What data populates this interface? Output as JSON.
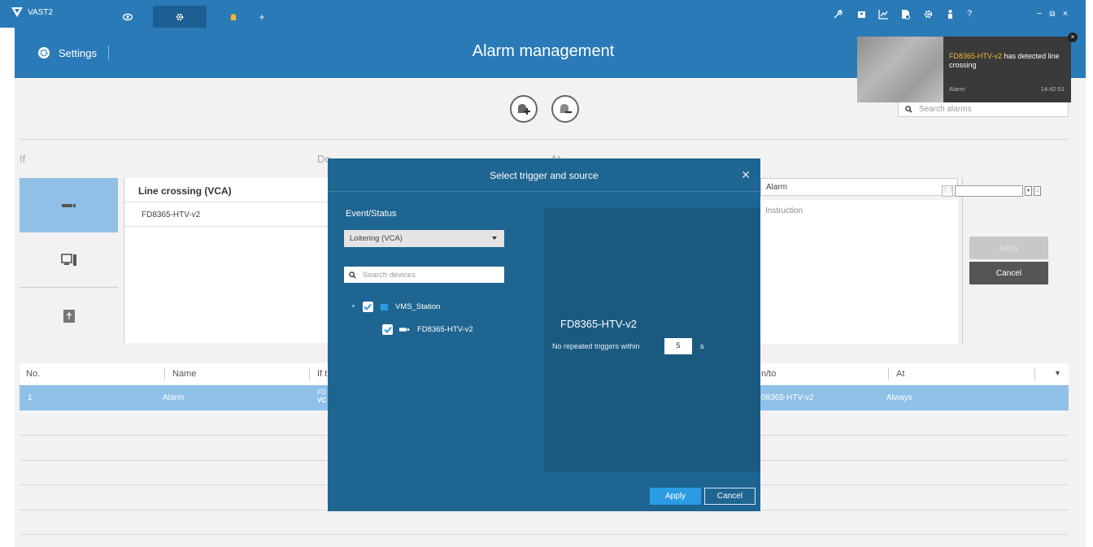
{
  "app": {
    "name": "VAST2"
  },
  "titlebar": {
    "tabs": [
      {
        "icon": "eye-icon",
        "label": ""
      },
      {
        "icon": "gear-icon",
        "label": "",
        "active": true
      },
      {
        "icon": "bell-icon",
        "label": ""
      },
      {
        "icon": "plus-icon",
        "label": "+"
      }
    ],
    "right_icons": [
      "wrench-icon",
      "id-card-icon",
      "chart-icon",
      "file-icon",
      "gear-icon",
      "person-icon",
      "help-icon"
    ],
    "window_controls": {
      "minimize": "−",
      "restore": "⧉",
      "close": "×"
    }
  },
  "header": {
    "settings_label": "Settings",
    "page_title": "Alarm management"
  },
  "search": {
    "placeholder": "Search alarms"
  },
  "sections": {
    "if_label": "If",
    "do_label": "Do",
    "at_label": "At"
  },
  "if_panel": {
    "trigger": "Line crossing (VCA)",
    "source": "FD8365-HTV-v2"
  },
  "right_panel": {
    "name": "Alarm",
    "instruction_placeholder": "Instruction",
    "apply": "Apply",
    "cancel": "Cancel"
  },
  "table": {
    "headers": [
      "No.",
      "Name",
      "If t",
      "n/to",
      "At"
    ],
    "rows": [
      {
        "no": "1",
        "name": "Alarm",
        "if_line1": "FD",
        "if_line2": "VC",
        "on_to": "08365-HTV-v2",
        "at": "Always"
      }
    ]
  },
  "notification": {
    "device": "FD8365-HTV-v2",
    "message": " has detected line crossing",
    "type": "Alarm",
    "time": "14:42:51"
  },
  "dialog": {
    "title": "Select trigger and source",
    "event_label": "Event/Status",
    "event_value": "Loitering (VCA)",
    "search_placeholder": "Search devices",
    "tree": [
      {
        "label": "VMS_Station",
        "checked": true,
        "level": 0
      },
      {
        "label": "FD8365-HTV-v2",
        "checked": true,
        "level": 1
      }
    ],
    "selected_device": "FD8365-HTV-v2",
    "no_repeat_label": "No repeated triggers within",
    "no_repeat_value": "5",
    "no_repeat_unit": "s",
    "apply": "Apply",
    "cancel": "Cancel"
  },
  "colors": {
    "primary": "#2a7ab8",
    "header_dark": "#1d5f92",
    "dialog": "#1f6591",
    "selection": "#8fc0e8",
    "accent_button": "#2b9be4",
    "notification_device": "#f5b82e"
  }
}
